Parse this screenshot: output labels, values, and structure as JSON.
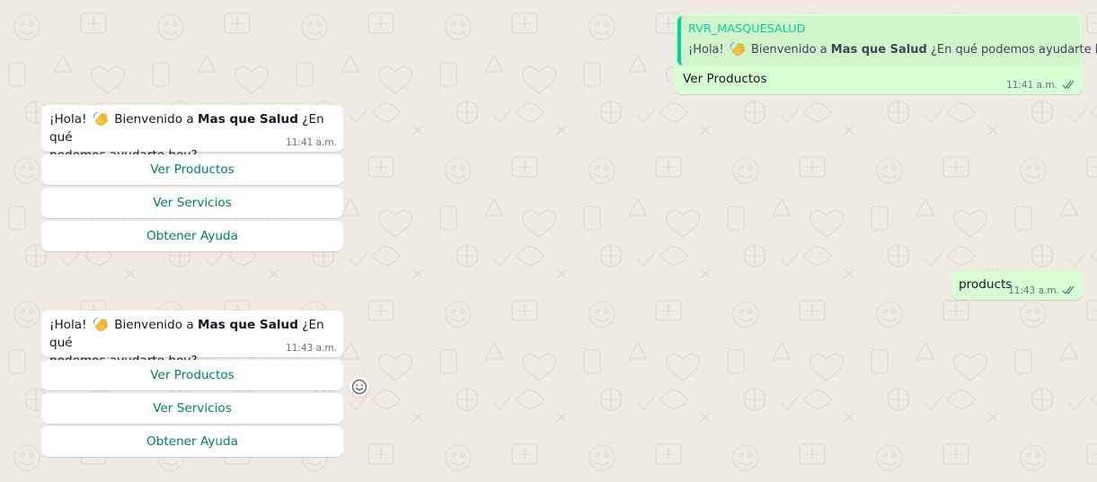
{
  "colors": {
    "background": "#efeae2",
    "incoming_bubble": "#ffffff",
    "outgoing_bubble": "#d9fdd3",
    "quote_accent": "#06cf9c",
    "button_text": "#008069",
    "read_ticks": "#53bdeb"
  },
  "incoming_1": {
    "greeting_start": "¡Hola!",
    "greeting_mid": "Bienvenido a",
    "brand": "Mas que Salud",
    "question_line1": "¿En qué",
    "question_line2": "podemos ayudarte hoy?",
    "time": "11:41 a.m.",
    "buttons": [
      "Ver Productos",
      "Ver Servicios",
      "Obtener Ayuda"
    ]
  },
  "incoming_2": {
    "greeting_start": "¡Hola!",
    "greeting_mid": "Bienvenido a",
    "brand": "Mas que Salud",
    "question_line1": "¿En qué",
    "question_line2": "podemos ayudarte hoy?",
    "time": "11:43 a.m.",
    "buttons": [
      "Ver Productos",
      "Ver Servicios",
      "Obtener Ayuda"
    ]
  },
  "outgoing_reply": {
    "quote_author": "RVR_MASQUESALUD",
    "quote_start": "¡Hola!",
    "quote_mid": "Bienvenido a",
    "quote_brand": "Mas que Salud",
    "quote_end": "¿En qué podemos ayudarte hoy?",
    "text": "Ver Productos",
    "time": "11:41 a.m."
  },
  "outgoing_products": {
    "text": "products",
    "time": "11:43 a.m."
  },
  "icons": {
    "wave": "waving-hand-icon",
    "ticks": "double-check-icon",
    "emoji": "smiley-icon"
  }
}
